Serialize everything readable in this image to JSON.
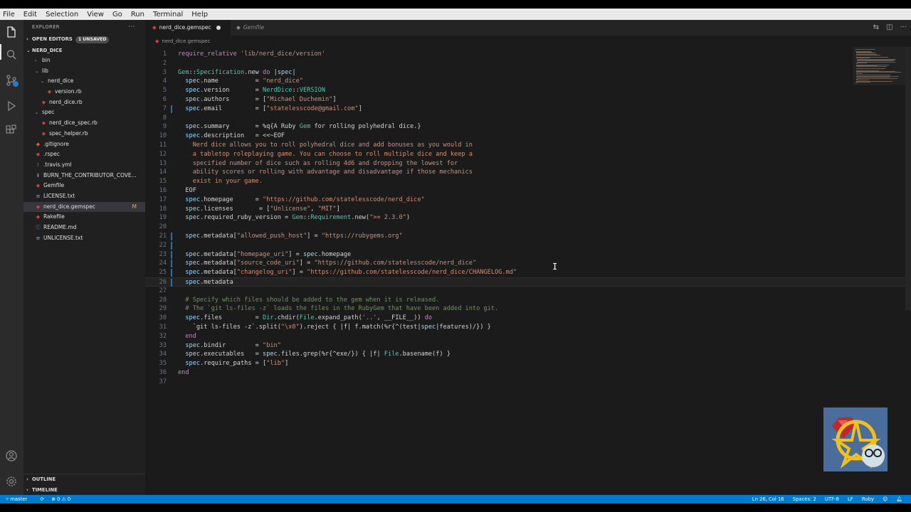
{
  "menu": [
    "File",
    "Edit",
    "Selection",
    "View",
    "Go",
    "Run",
    "Terminal",
    "Help"
  ],
  "sidebar": {
    "title": "EXPLORER",
    "open_editors": {
      "label": "OPEN EDITORS",
      "badge": "1 UNSAVED"
    },
    "project": "NERD_DICE",
    "tree": [
      {
        "name": "bin",
        "indent": 1,
        "type": "folder",
        "open": false
      },
      {
        "name": "lib",
        "indent": 1,
        "type": "folder",
        "open": true
      },
      {
        "name": "nerd_dice",
        "indent": 2,
        "type": "folder",
        "open": true
      },
      {
        "name": "version.rb",
        "indent": 3,
        "type": "ruby"
      },
      {
        "name": "nerd_dice.rb",
        "indent": 2,
        "type": "ruby"
      },
      {
        "name": "spec",
        "indent": 1,
        "type": "folder",
        "open": true
      },
      {
        "name": "nerd_dice_spec.rb",
        "indent": 2,
        "type": "ruby"
      },
      {
        "name": "spec_helper.rb",
        "indent": 2,
        "type": "ruby"
      },
      {
        "name": ".gitignore",
        "indent": 1,
        "type": "git"
      },
      {
        "name": ".rspec",
        "indent": 1,
        "type": "ruby"
      },
      {
        "name": ".travis.yml",
        "indent": 1,
        "type": "yml"
      },
      {
        "name": "BURN_THE_CONTRIBUTOR_COVE...",
        "indent": 1,
        "type": "md"
      },
      {
        "name": "Gemfile",
        "indent": 1,
        "type": "ruby"
      },
      {
        "name": "LICENSE.txt",
        "indent": 1,
        "type": "txt"
      },
      {
        "name": "nerd_dice.gemspec",
        "indent": 1,
        "type": "ruby",
        "selected": true,
        "git": "M"
      },
      {
        "name": "Rakefile",
        "indent": 1,
        "type": "ruby"
      },
      {
        "name": "README.md",
        "indent": 1,
        "type": "info"
      },
      {
        "name": "UNLICENSE.txt",
        "indent": 1,
        "type": "txt"
      }
    ],
    "outline": "OUTLINE",
    "timeline": "TIMELINE"
  },
  "tabs": [
    {
      "label": "nerd_dice.gemspec",
      "active": true,
      "dirty": true
    },
    {
      "label": "Gemfile",
      "active": false
    }
  ],
  "breadcrumb": "nerd_dice.gemspec",
  "code_lines": [
    "require_relative 'lib/nerd_dice/version'",
    "",
    "Gem::Specification.new do |spec|",
    "  spec.name          = \"nerd_dice\"",
    "  spec.version       = NerdDice::VERSION",
    "  spec.authors       = [\"Michael Duchemin\"]",
    "  spec.email         = [\"statelesscode@gmail.com\"]",
    "",
    "  spec.summary       = %q{A Ruby Gem for rolling polyhedral dice.}",
    "  spec.description   = <<~EOF",
    "    Nerd dice allows you to roll polyhedral dice and add bonuses as you would in",
    "    a tabletop roleplaying game. You can choose to roll multiple dice and keep a",
    "    specified number of dice such as rolling 4d6 and dropping the lowest for",
    "    ability scores or rolling with advantage and disadvantage if those mechanics",
    "    exist in your game.",
    "  EOF",
    "  spec.homepage      = \"https://github.com/statelesscode/nerd_dice\"",
    "  spec.licenses       = [\"Unlicense\", \"MIT\"]",
    "  spec.required_ruby_version = Gem::Requirement.new(\">= 2.3.0\")",
    "",
    "  spec.metadata[\"allowed_push_host\"] = \"https://rubygems.org\"",
    "",
    "  spec.metadata[\"homepage_uri\"] = spec.homepage",
    "  spec.metadata[\"source_code_uri\"] = \"https://github.com/statelesscode/nerd_dice\"",
    "  spec.metadata[\"changelog_uri\"] = \"https://github.com/statelesscode/nerd_dice/CHANGELOG.md\"",
    "  spec.metadata",
    "",
    "  # Specify which files should be added to the gem when it is released.",
    "  # The `git ls-files -z` loads the files in the RubyGem that have been added into git.",
    "  spec.files         = Dir.chdir(File.expand_path('..', __FILE__)) do",
    "    `git ls-files -z`.split(\"\\x0\").reject { |f| f.match(%r{^(test|spec|features)/}) }",
    "  end",
    "  spec.bindir        = \"bin\"",
    "  spec.executables   = spec.files.grep(%r{^exe/}) { |f| File.basename(f) }",
    "  spec.require_paths = [\"lib\"]",
    "end",
    ""
  ],
  "status": {
    "branch": "master",
    "sync": "⟳",
    "problems": "⊗ 0 ⚠ 0",
    "position": "Ln 26, Col 16",
    "spaces": "Spaces: 2",
    "encoding": "UTF-8",
    "eol": "LF",
    "language": "Ruby"
  },
  "icons": {
    "explorer": "files-icon",
    "search": "search-icon",
    "scm": "source-control-icon",
    "debug": "run-debug-icon",
    "extensions": "extensions-icon",
    "account": "account-icon",
    "settings": "gear-icon"
  }
}
